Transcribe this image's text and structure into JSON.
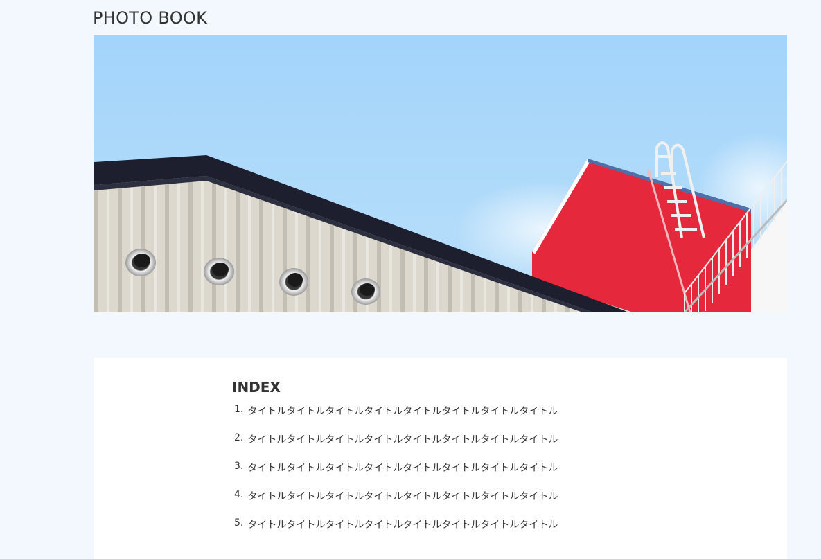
{
  "site": {
    "title": "PHOTO BOOK"
  },
  "hero": {
    "image_icon": "building-photo"
  },
  "index": {
    "heading": "INDEX",
    "items": [
      {
        "number": "1.",
        "title": "タイトルタイトルタイトルタイトルタイトルタイトルタイトルタイトル"
      },
      {
        "number": "2.",
        "title": "タイトルタイトルタイトルタイトルタイトルタイトルタイトルタイトル"
      },
      {
        "number": "3.",
        "title": "タイトルタイトルタイトルタイトルタイトルタイトルタイトルタイトル"
      },
      {
        "number": "4.",
        "title": "タイトルタイトルタイトルタイトルタイトルタイトルタイトルタイトル"
      },
      {
        "number": "5.",
        "title": "タイトルタイトルタイトルタイトルタイトルタイトルタイトルタイトル"
      }
    ]
  },
  "colors": {
    "page_background": "#f3f8ff",
    "sky": "#a7d6fb",
    "roof": "#1d1f2e",
    "wall": "#d6d2c8",
    "red_building": "#e5283b"
  }
}
